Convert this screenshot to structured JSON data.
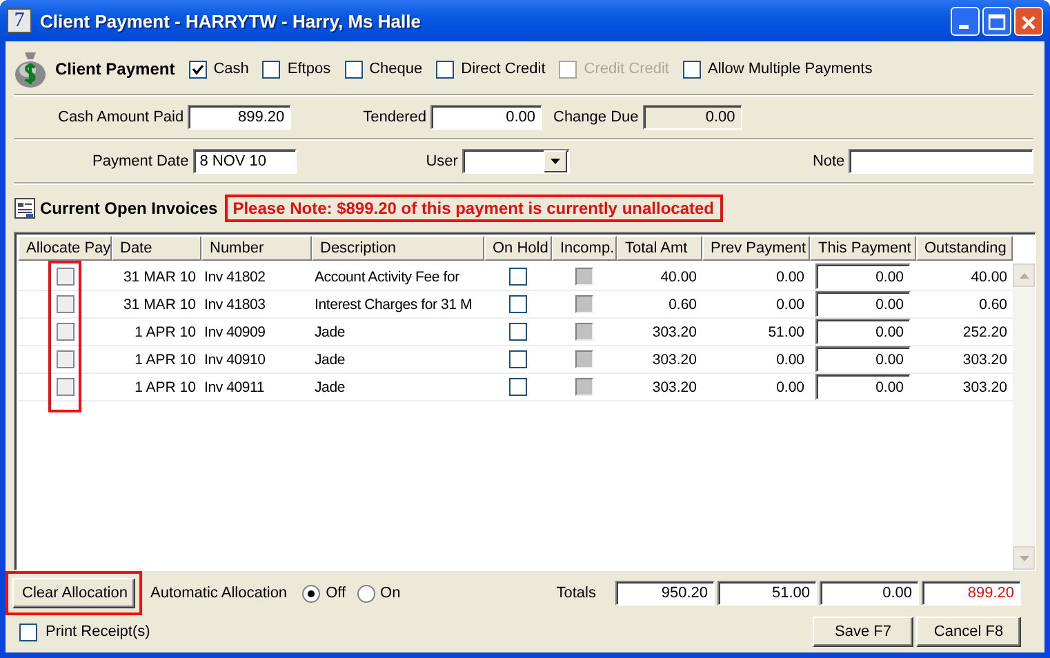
{
  "window": {
    "title": "Client Payment - HARRYTW - Harry, Ms Halle",
    "app_icon": "7"
  },
  "payment_types": {
    "title": "Client Payment",
    "options": [
      {
        "label": "Cash",
        "checked": true,
        "disabled": false
      },
      {
        "label": "Eftpos",
        "checked": false,
        "disabled": false
      },
      {
        "label": "Cheque",
        "checked": false,
        "disabled": false
      },
      {
        "label": "Direct Credit",
        "checked": false,
        "disabled": false
      },
      {
        "label": "Credit Credit",
        "checked": false,
        "disabled": true
      },
      {
        "label": "Allow Multiple Payments",
        "checked": false,
        "disabled": false
      }
    ]
  },
  "amount_row": [
    {
      "label": "Cash Amount Paid",
      "value": "899.20",
      "readonly": false
    },
    {
      "label": "Tendered",
      "value": "0.00",
      "readonly": false
    },
    {
      "label": "Change Due",
      "value": "0.00",
      "readonly": true
    }
  ],
  "date_row": {
    "payment_date": {
      "label": "Payment Date",
      "value": "8 NOV 10"
    },
    "user": {
      "label": "User"
    },
    "note": {
      "label": "Note"
    }
  },
  "invoices": {
    "title": "Current Open Invoices",
    "notice": "Please Note: $899.20 of this payment is currently unallocated",
    "columns": [
      "Allocate Pay",
      "Date",
      "Number",
      "Description",
      "On Hold",
      "Incomp.",
      "Total Amt",
      "Prev Payment",
      "This Payment",
      "Outstanding"
    ],
    "allocate_highlighted": true,
    "rows": [
      {
        "allocate": false,
        "date": "31 MAR 10",
        "number": "Inv 41802",
        "description": "Account Activity Fee for",
        "on_hold": false,
        "incomplete": false,
        "total": "40.00",
        "prev": "0.00",
        "this": "0.00",
        "outstanding": "40.00"
      },
      {
        "allocate": false,
        "date": "31 MAR 10",
        "number": "Inv 41803",
        "description": "Interest Charges for 31 M",
        "on_hold": false,
        "incomplete": false,
        "total": "0.60",
        "prev": "0.00",
        "this": "0.00",
        "outstanding": "0.60"
      },
      {
        "allocate": false,
        "date": "1 APR 10",
        "number": "Inv 40909",
        "description": "Jade",
        "on_hold": false,
        "incomplete": false,
        "total": "303.20",
        "prev": "51.00",
        "this": "0.00",
        "outstanding": "252.20"
      },
      {
        "allocate": false,
        "date": "1 APR 10",
        "number": "Inv 40910",
        "description": "Jade",
        "on_hold": false,
        "incomplete": false,
        "total": "303.20",
        "prev": "0.00",
        "this": "0.00",
        "outstanding": "303.20"
      },
      {
        "allocate": false,
        "date": "1 APR 10",
        "number": "Inv 40911",
        "description": "Jade",
        "on_hold": false,
        "incomplete": false,
        "total": "303.20",
        "prev": "0.00",
        "this": "0.00",
        "outstanding": "303.20"
      }
    ]
  },
  "clear_button": {
    "label": "Clear Allocation",
    "highlighted": true
  },
  "auto_allocation": {
    "label": "Automatic Allocation",
    "options": [
      {
        "label": "Off",
        "selected": true
      },
      {
        "label": "On",
        "selected": false
      }
    ]
  },
  "totals": {
    "label": "Totals",
    "values": [
      "950.20",
      "51.00",
      "0.00",
      "899.20"
    ]
  },
  "print_receipt": {
    "label": "Print Receipt(s)",
    "checked": false
  },
  "buttons": [
    "Save F7",
    "Cancel F8"
  ]
}
